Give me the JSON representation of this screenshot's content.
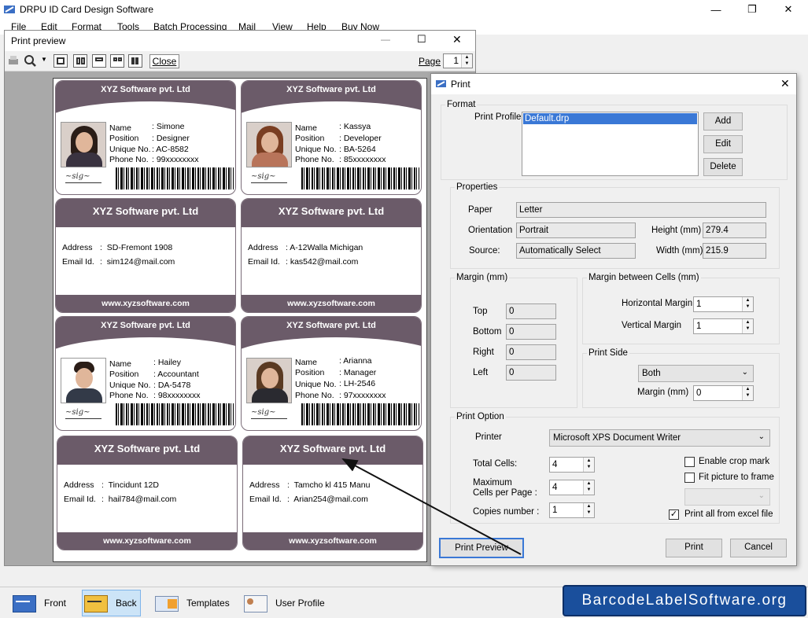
{
  "main": {
    "title": "DRPU ID Card Design Software",
    "menu": [
      "File",
      "Edit",
      "Format",
      "Tools",
      "Batch Processing",
      "Mail",
      "View",
      "Help",
      "Buy Now"
    ]
  },
  "preview": {
    "title": "Print preview",
    "close_label": "Close",
    "page_label": "Page",
    "page_value": "1",
    "company": "XYZ Software pvt. Ltd",
    "website": "www.xyzsoftware.com",
    "field_labels": {
      "name": "Name",
      "position": "Position",
      "unique": "Unique No.",
      "phone": "Phone No.",
      "address": "Address",
      "email": "Email Id."
    },
    "cards": [
      {
        "name": "Simone",
        "position": "Designer",
        "unique": "AC-8582",
        "phone": "99xxxxxxxx",
        "address": "SD-Fremont 1908",
        "email": "sim124@mail.com"
      },
      {
        "name": "Kassya",
        "position": "Developer",
        "unique": "BA-5264",
        "phone": "85xxxxxxxx",
        "address": "A-12Walla Michigan",
        "email": "kas542@mail.com"
      },
      {
        "name": "Hailey",
        "position": "Accountant",
        "unique": "DA-5478",
        "phone": "98xxxxxxxx",
        "address": "Tincidunt 12D",
        "email": "hail784@mail.com"
      },
      {
        "name": "Arianna",
        "position": "Manager",
        "unique": "LH-2546",
        "phone": "97xxxxxxxx",
        "address": "Tamcho kl 415 Manu",
        "email": "Arian254@mail.com"
      }
    ]
  },
  "print": {
    "title": "Print",
    "format": {
      "group": "Format",
      "profile_label": "Print Profile",
      "profile_selected": "Default.drp",
      "add": "Add",
      "edit": "Edit",
      "delete": "Delete"
    },
    "properties": {
      "group": "Properties",
      "paper_label": "Paper",
      "paper": "Letter",
      "orientation_label": "Orientation",
      "orientation": "Portrait",
      "source_label": "Source:",
      "source": "Automatically Select",
      "height_label": "Height (mm)",
      "height": "279.4",
      "width_label": "Width (mm)",
      "width": "215.9"
    },
    "margin": {
      "group": "Margin (mm)",
      "top_label": "Top",
      "top": "0",
      "bottom_label": "Bottom",
      "bottom": "0",
      "right_label": "Right",
      "right": "0",
      "left_label": "Left",
      "left": "0"
    },
    "cell_margin": {
      "group": "Margin between Cells (mm)",
      "horizontal_label": "Horizontal Margin",
      "horizontal": "1",
      "vertical_label": "Vertical Margin",
      "vertical": "1"
    },
    "print_side": {
      "group": "Print Side",
      "value": "Both",
      "margin_label": "Margin (mm)",
      "margin": "0"
    },
    "option": {
      "group": "Print Option",
      "printer_label": "Printer",
      "printer": "Microsoft XPS Document Writer",
      "total_cells_label": "Total Cells:",
      "total_cells": "4",
      "max_cells_label1": "Maximum",
      "max_cells_label2": "Cells per Page :",
      "max_cells": "4",
      "copies_label": "Copies number :",
      "copies": "1",
      "crop_mark": "Enable crop mark",
      "fit_picture": "Fit picture to frame",
      "print_excel": "Print all from excel file"
    },
    "buttons": {
      "preview": "Print Preview",
      "print": "Print",
      "cancel": "Cancel"
    }
  },
  "bottom": {
    "items": [
      "Front",
      "Back",
      "Templates",
      "User Profile"
    ],
    "brand": "BarcodeLabelSoftware.org"
  }
}
